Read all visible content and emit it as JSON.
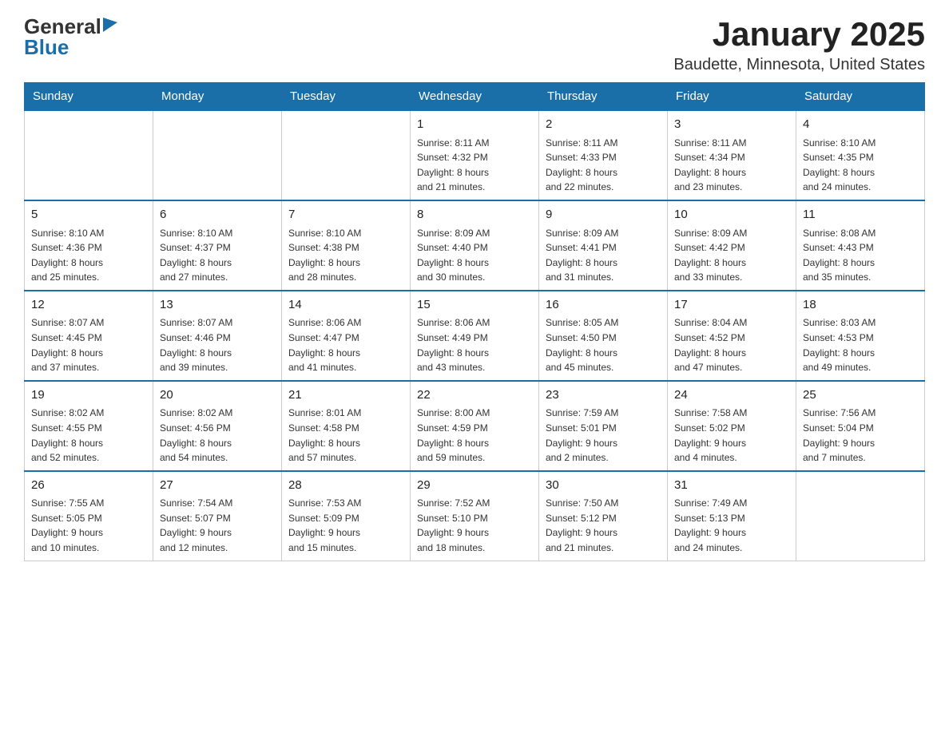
{
  "logo": {
    "general": "General",
    "blue": "Blue"
  },
  "title": "January 2025",
  "subtitle": "Baudette, Minnesota, United States",
  "weekdays": [
    "Sunday",
    "Monday",
    "Tuesday",
    "Wednesday",
    "Thursday",
    "Friday",
    "Saturday"
  ],
  "weeks": [
    [
      {
        "day": "",
        "info": ""
      },
      {
        "day": "",
        "info": ""
      },
      {
        "day": "",
        "info": ""
      },
      {
        "day": "1",
        "info": "Sunrise: 8:11 AM\nSunset: 4:32 PM\nDaylight: 8 hours\nand 21 minutes."
      },
      {
        "day": "2",
        "info": "Sunrise: 8:11 AM\nSunset: 4:33 PM\nDaylight: 8 hours\nand 22 minutes."
      },
      {
        "day": "3",
        "info": "Sunrise: 8:11 AM\nSunset: 4:34 PM\nDaylight: 8 hours\nand 23 minutes."
      },
      {
        "day": "4",
        "info": "Sunrise: 8:10 AM\nSunset: 4:35 PM\nDaylight: 8 hours\nand 24 minutes."
      }
    ],
    [
      {
        "day": "5",
        "info": "Sunrise: 8:10 AM\nSunset: 4:36 PM\nDaylight: 8 hours\nand 25 minutes."
      },
      {
        "day": "6",
        "info": "Sunrise: 8:10 AM\nSunset: 4:37 PM\nDaylight: 8 hours\nand 27 minutes."
      },
      {
        "day": "7",
        "info": "Sunrise: 8:10 AM\nSunset: 4:38 PM\nDaylight: 8 hours\nand 28 minutes."
      },
      {
        "day": "8",
        "info": "Sunrise: 8:09 AM\nSunset: 4:40 PM\nDaylight: 8 hours\nand 30 minutes."
      },
      {
        "day": "9",
        "info": "Sunrise: 8:09 AM\nSunset: 4:41 PM\nDaylight: 8 hours\nand 31 minutes."
      },
      {
        "day": "10",
        "info": "Sunrise: 8:09 AM\nSunset: 4:42 PM\nDaylight: 8 hours\nand 33 minutes."
      },
      {
        "day": "11",
        "info": "Sunrise: 8:08 AM\nSunset: 4:43 PM\nDaylight: 8 hours\nand 35 minutes."
      }
    ],
    [
      {
        "day": "12",
        "info": "Sunrise: 8:07 AM\nSunset: 4:45 PM\nDaylight: 8 hours\nand 37 minutes."
      },
      {
        "day": "13",
        "info": "Sunrise: 8:07 AM\nSunset: 4:46 PM\nDaylight: 8 hours\nand 39 minutes."
      },
      {
        "day": "14",
        "info": "Sunrise: 8:06 AM\nSunset: 4:47 PM\nDaylight: 8 hours\nand 41 minutes."
      },
      {
        "day": "15",
        "info": "Sunrise: 8:06 AM\nSunset: 4:49 PM\nDaylight: 8 hours\nand 43 minutes."
      },
      {
        "day": "16",
        "info": "Sunrise: 8:05 AM\nSunset: 4:50 PM\nDaylight: 8 hours\nand 45 minutes."
      },
      {
        "day": "17",
        "info": "Sunrise: 8:04 AM\nSunset: 4:52 PM\nDaylight: 8 hours\nand 47 minutes."
      },
      {
        "day": "18",
        "info": "Sunrise: 8:03 AM\nSunset: 4:53 PM\nDaylight: 8 hours\nand 49 minutes."
      }
    ],
    [
      {
        "day": "19",
        "info": "Sunrise: 8:02 AM\nSunset: 4:55 PM\nDaylight: 8 hours\nand 52 minutes."
      },
      {
        "day": "20",
        "info": "Sunrise: 8:02 AM\nSunset: 4:56 PM\nDaylight: 8 hours\nand 54 minutes."
      },
      {
        "day": "21",
        "info": "Sunrise: 8:01 AM\nSunset: 4:58 PM\nDaylight: 8 hours\nand 57 minutes."
      },
      {
        "day": "22",
        "info": "Sunrise: 8:00 AM\nSunset: 4:59 PM\nDaylight: 8 hours\nand 59 minutes."
      },
      {
        "day": "23",
        "info": "Sunrise: 7:59 AM\nSunset: 5:01 PM\nDaylight: 9 hours\nand 2 minutes."
      },
      {
        "day": "24",
        "info": "Sunrise: 7:58 AM\nSunset: 5:02 PM\nDaylight: 9 hours\nand 4 minutes."
      },
      {
        "day": "25",
        "info": "Sunrise: 7:56 AM\nSunset: 5:04 PM\nDaylight: 9 hours\nand 7 minutes."
      }
    ],
    [
      {
        "day": "26",
        "info": "Sunrise: 7:55 AM\nSunset: 5:05 PM\nDaylight: 9 hours\nand 10 minutes."
      },
      {
        "day": "27",
        "info": "Sunrise: 7:54 AM\nSunset: 5:07 PM\nDaylight: 9 hours\nand 12 minutes."
      },
      {
        "day": "28",
        "info": "Sunrise: 7:53 AM\nSunset: 5:09 PM\nDaylight: 9 hours\nand 15 minutes."
      },
      {
        "day": "29",
        "info": "Sunrise: 7:52 AM\nSunset: 5:10 PM\nDaylight: 9 hours\nand 18 minutes."
      },
      {
        "day": "30",
        "info": "Sunrise: 7:50 AM\nSunset: 5:12 PM\nDaylight: 9 hours\nand 21 minutes."
      },
      {
        "day": "31",
        "info": "Sunrise: 7:49 AM\nSunset: 5:13 PM\nDaylight: 9 hours\nand 24 minutes."
      },
      {
        "day": "",
        "info": ""
      }
    ]
  ]
}
